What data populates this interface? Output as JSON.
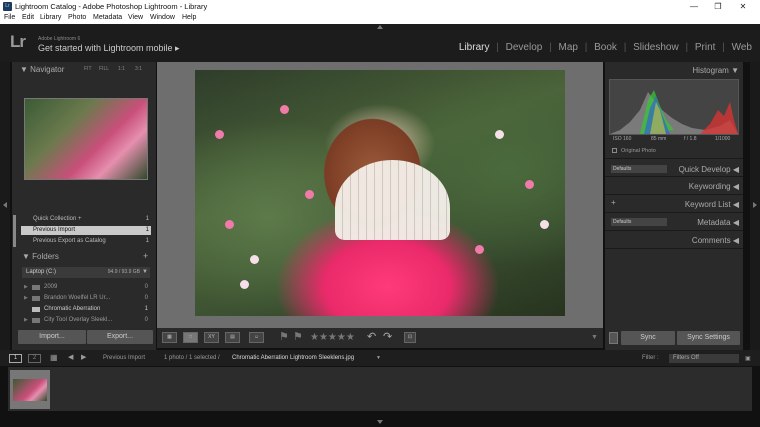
{
  "window": {
    "title": "Lightroom Catalog - Adobe Photoshop Lightroom - Library",
    "app_icon_label": "Lr"
  },
  "menu": [
    "File",
    "Edit",
    "Library",
    "Photo",
    "Metadata",
    "View",
    "Window",
    "Help"
  ],
  "identity": {
    "logo": "Lr",
    "subtitle": "Adobe Lightroom 6",
    "cta": "Get started with Lightroom mobile ▸"
  },
  "modules": {
    "library": "Library",
    "develop": "Develop",
    "map": "Map",
    "book": "Book",
    "slideshow": "Slideshow",
    "print": "Print",
    "web": "Web",
    "separator": "|"
  },
  "navigator": {
    "title": "Navigator",
    "fit": "FIT",
    "fill": "FILL",
    "one_to_one": "1:1",
    "three_to_one": "3:1"
  },
  "collections": [
    {
      "label": "Quick Collection +",
      "count": "1"
    },
    {
      "label": "Previous Import",
      "count": "1"
    },
    {
      "label": "Previous Export as Catalog",
      "count": "1"
    }
  ],
  "folders": {
    "title": "Folders",
    "add": "+",
    "volume_label": "Laptop (C:)",
    "volume_size": "94.9 / 93.9 GB",
    "items": [
      {
        "label": "2009",
        "count": "0"
      },
      {
        "label": "Brandon Woelfel LR Ur...",
        "count": "0"
      },
      {
        "label": "Chromatic Aberration",
        "count": "1"
      },
      {
        "label": "City Tool Overlay Sleekl...",
        "count": "0"
      }
    ]
  },
  "buttons": {
    "import": "Import...",
    "export": "Export...",
    "sync": "Sync",
    "sync_settings": "Sync Settings"
  },
  "toolbar": {
    "view_xy": "XY",
    "stars": "★★★★★"
  },
  "right_panel": {
    "histogram": "Histogram",
    "iso": "ISO 160",
    "focal": "85 mm",
    "aperture": "f / 1.8",
    "shutter": "1/1000",
    "original_photo": "Original Photo",
    "quick_develop": "Quick Develop",
    "defaults": "Defaults",
    "keywording": "Keywording",
    "keyword_list": "Keyword List",
    "keyword_add": "+",
    "metadata": "Metadata",
    "comments": "Comments"
  },
  "filmstrip": {
    "page1": "1",
    "page2": "2",
    "source": "Previous Import",
    "selection": "1 photo / 1 selected /",
    "filename": "Chromatic Aberration Lightroom Sleeklens.jpg",
    "filter_label": "Filter :",
    "filter_value": "Filters Off"
  },
  "colors": {
    "active_module": "#dddddd",
    "panel": "#2a2a2a",
    "selected_row": "#c9c9c9"
  }
}
